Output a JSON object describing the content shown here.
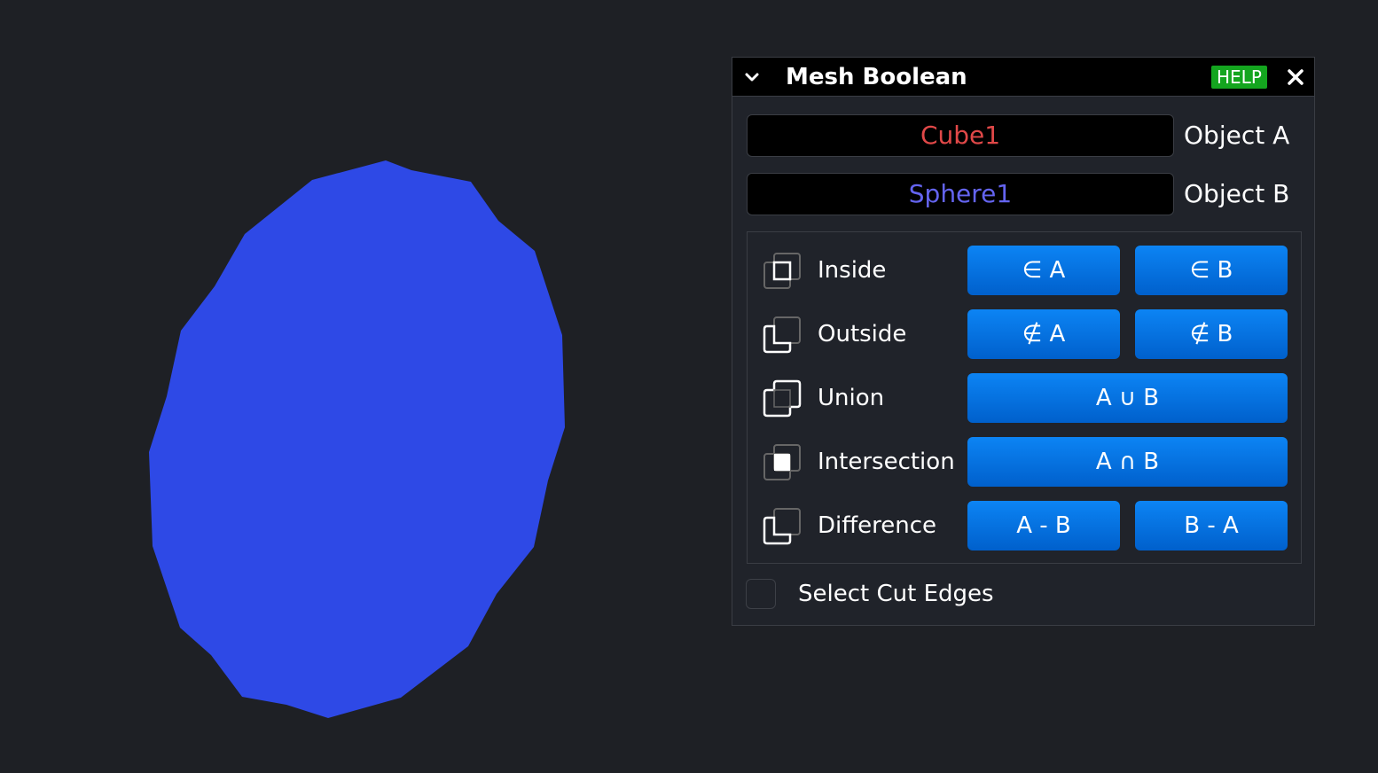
{
  "panel": {
    "title": "Mesh Boolean",
    "help_label": "HELP",
    "object_a": {
      "value": "Cube1",
      "label": "Object A",
      "color": "#e04848"
    },
    "object_b": {
      "value": "Sphere1",
      "label": "Object B",
      "color": "#6464f0"
    },
    "operations": [
      {
        "label": "Inside",
        "icon": "inside-icon",
        "buttons": [
          "∈ A",
          "∈ B"
        ]
      },
      {
        "label": "Outside",
        "icon": "outside-icon",
        "buttons": [
          "∉ A",
          "∉ B"
        ]
      },
      {
        "label": "Union",
        "icon": "union-icon",
        "buttons": [
          "A ∪ B"
        ]
      },
      {
        "label": "Intersection",
        "icon": "intersection-icon",
        "buttons": [
          "A ∩ B"
        ]
      },
      {
        "label": "Difference",
        "icon": "difference-icon",
        "buttons": [
          "A - B",
          "B - A"
        ]
      }
    ],
    "select_cut_edges": {
      "label": "Select Cut Edges",
      "checked": false
    }
  },
  "viewport": {
    "mesh_color": "#2e49e6"
  },
  "colors": {
    "background": "#1e2025",
    "button": "#0a78ee",
    "help": "#14a51f"
  }
}
